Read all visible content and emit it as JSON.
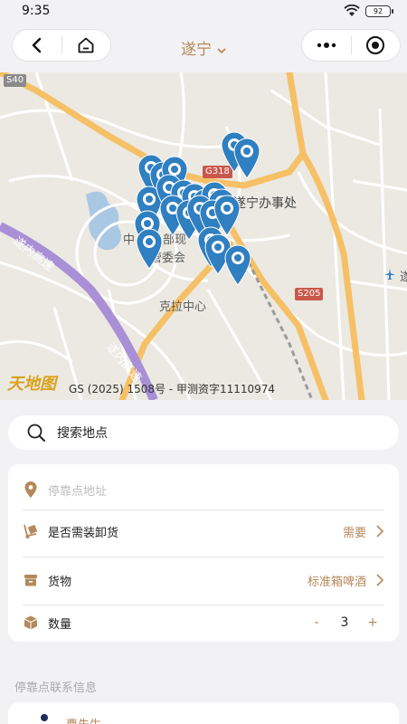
{
  "status": {
    "time": "9:35",
    "battery": "92"
  },
  "header": {
    "city": "遂宁"
  },
  "map": {
    "labels": {
      "s40": "S40",
      "g318": "G318",
      "s205": "S205",
      "office": "遂宁办事处",
      "expressway": "遂内高速",
      "expressway2": "遂内高速",
      "district": "中",
      "district2": "部现",
      "committee": "管委会",
      "kela": "克拉中心",
      "airport_right": "遂"
    },
    "logo": "天地图",
    "copyright": "GS (2025) 1508号 - 甲测资字11110974"
  },
  "search": {
    "placeholder": "搜索地点"
  },
  "form": {
    "address_placeholder": "停靠点地址",
    "unload_label": "是否需装卸货",
    "unload_value": "需要",
    "goods_label": "货物",
    "goods_value": "标准箱啤酒",
    "quantity_label": "数量",
    "quantity_minus": "-",
    "quantity_value": "3",
    "quantity_plus": "+"
  },
  "contact": {
    "section_title": "停靠点联系信息",
    "name": "曹先生"
  },
  "colors": {
    "accent": "#b5895b",
    "pin": "#2f7fc1"
  }
}
